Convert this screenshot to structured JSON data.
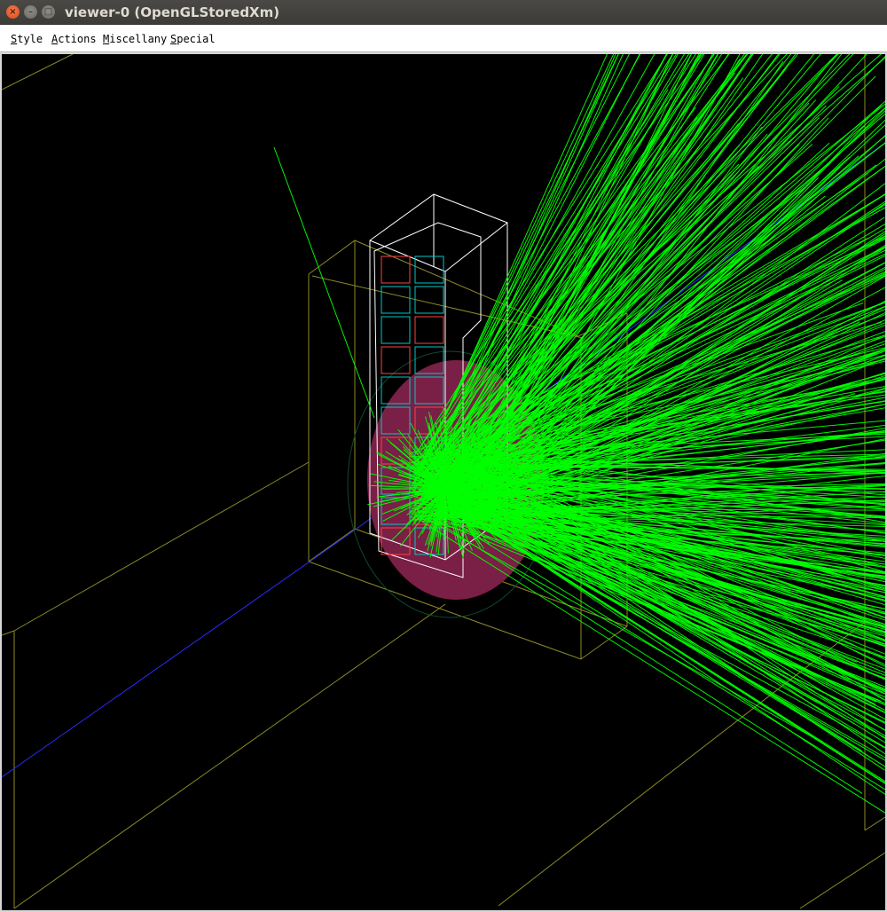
{
  "window": {
    "title": "viewer-0 (OpenGLStoredXm)",
    "buttons": {
      "close": "×",
      "minimize": "–",
      "maximize": "□"
    }
  },
  "menubar": {
    "items": [
      {
        "mnemonic": "S",
        "rest": "tyle"
      },
      {
        "mnemonic": "A",
        "rest": "ctions"
      },
      {
        "mnemonic": "M",
        "rest": "iscellany"
      },
      {
        "mnemonic": "S",
        "rest": "pecial"
      }
    ]
  },
  "scene": {
    "background": "#000000",
    "colors": {
      "trajectory": "#00ff00",
      "world_volume": "#8c8a28",
      "detector_frame": "#ffffff",
      "crystal_cells": "#00c8c8",
      "cell_edges": "#ff4040",
      "target_sphere": "#7a1f45",
      "beam_axis": "#2a2aff"
    }
  }
}
